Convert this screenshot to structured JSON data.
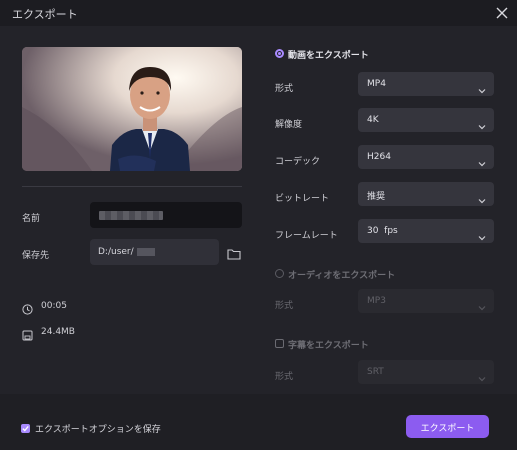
{
  "window": {
    "title": "エクスポート"
  },
  "left": {
    "name_label": "名前",
    "save_label": "保存先",
    "save_path": "D:/user/",
    "duration": "00:05",
    "file_size": "24.4MB"
  },
  "video_section": {
    "label": "動画をエクスポート",
    "fields": [
      {
        "label": "形式",
        "value": "MP4"
      },
      {
        "label": "解像度",
        "value": "4K"
      },
      {
        "label": "コーデック",
        "value": "H264"
      },
      {
        "label": "ビットレート",
        "value": "推奨"
      },
      {
        "label": "フレームレート",
        "value": "30  fps"
      }
    ]
  },
  "audio_section": {
    "label": "オーディオをエクスポート",
    "format_label": "形式",
    "format_value": "MP3"
  },
  "subtitle_section": {
    "label": "字幕をエクスポート",
    "format_label": "形式",
    "format_value": "SRT"
  },
  "footer": {
    "save_options_label": "エクスポートオプションを保存",
    "export_button": "エクスポート"
  },
  "colors": {
    "accent": "#8c5cf0",
    "background": "#232329"
  }
}
